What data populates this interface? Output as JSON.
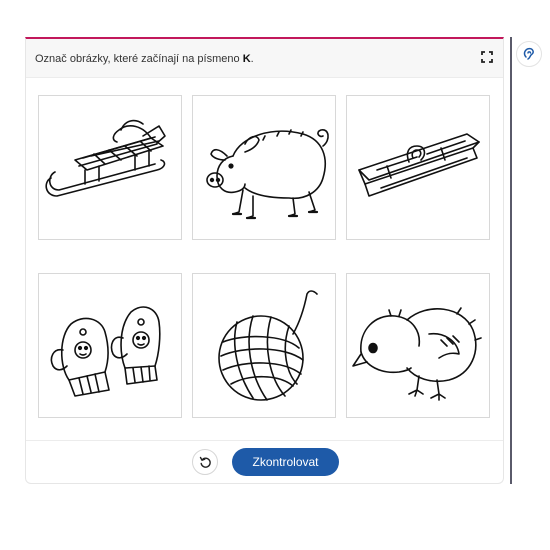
{
  "task": {
    "instruction_prefix": "Označ obrázky, které začínají na písmeno ",
    "instruction_letter": "K",
    "instruction_suffix": "."
  },
  "header": {
    "fullscreen_icon": "fullscreen-icon"
  },
  "images": [
    {
      "subject": "sledge",
      "icon": "sledge-icon"
    },
    {
      "subject": "pig",
      "icon": "pig-icon"
    },
    {
      "subject": "clothespin",
      "icon": "clothespin-icon"
    },
    {
      "subject": "mittens",
      "icon": "mittens-icon"
    },
    {
      "subject": "ball-of-yarn",
      "icon": "yarn-ball-icon"
    },
    {
      "subject": "chick",
      "icon": "chick-icon"
    }
  ],
  "footer": {
    "reset_icon": "reset-icon",
    "check_label": "Zkontrolovat"
  },
  "sidebar": {
    "tool_icon": "ear-icon"
  },
  "colors": {
    "accent_top": "#c2185b",
    "primary_button": "#1e5aa8",
    "sidebar_divider": "#5a5a6a"
  }
}
